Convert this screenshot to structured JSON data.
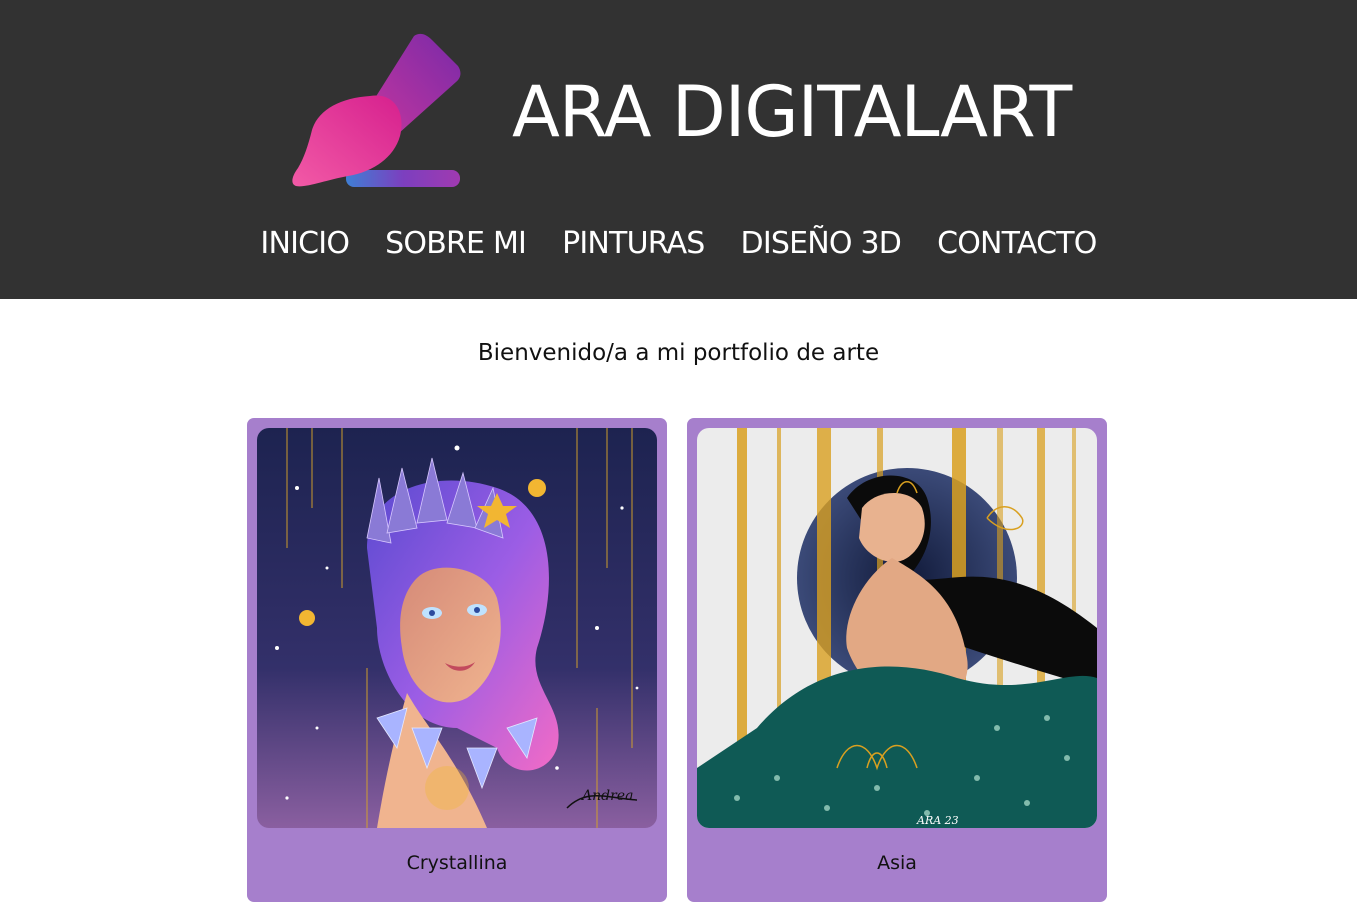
{
  "header": {
    "site_title": "ARA DIGITALART",
    "logo_icon": "paintbrush-logo-icon",
    "background_color": "#323232"
  },
  "nav": {
    "items": [
      {
        "label": "INICIO"
      },
      {
        "label": "SOBRE MI"
      },
      {
        "label": "PINTURAS"
      },
      {
        "label": "DISEÑO 3D"
      },
      {
        "label": "CONTACTO"
      }
    ]
  },
  "main": {
    "welcome": "Bienvenido/a a mi portfolio de arte",
    "cards": [
      {
        "title": "Crystallina",
        "image": "crystallina-painting"
      },
      {
        "title": "Asia",
        "image": "asia-painting"
      }
    ],
    "card_color": "#a67fcc"
  }
}
